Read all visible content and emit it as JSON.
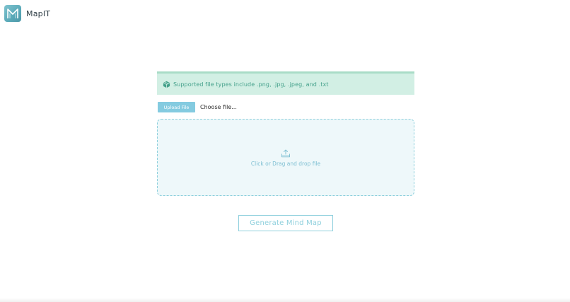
{
  "header": {
    "app_title": "MapIT",
    "logo_icon": "mapit-logo-icon"
  },
  "alert": {
    "icon": "package-icon",
    "text": "Supported file types include .png, .jpg, .jpeg, and .txt"
  },
  "upload": {
    "button_label": "Upload File",
    "file_name": "Choose file..."
  },
  "dropzone": {
    "icon": "upload-icon",
    "text": "Click or Drag and drop file"
  },
  "actions": {
    "generate_label": "Generate Mind Map"
  },
  "colors": {
    "accent": "#84cbe0",
    "alert_bg": "#d2efe4",
    "alert_text": "#43a08a",
    "dropzone_bg": "#eef8fa",
    "dropzone_border": "#8ccfdc"
  }
}
